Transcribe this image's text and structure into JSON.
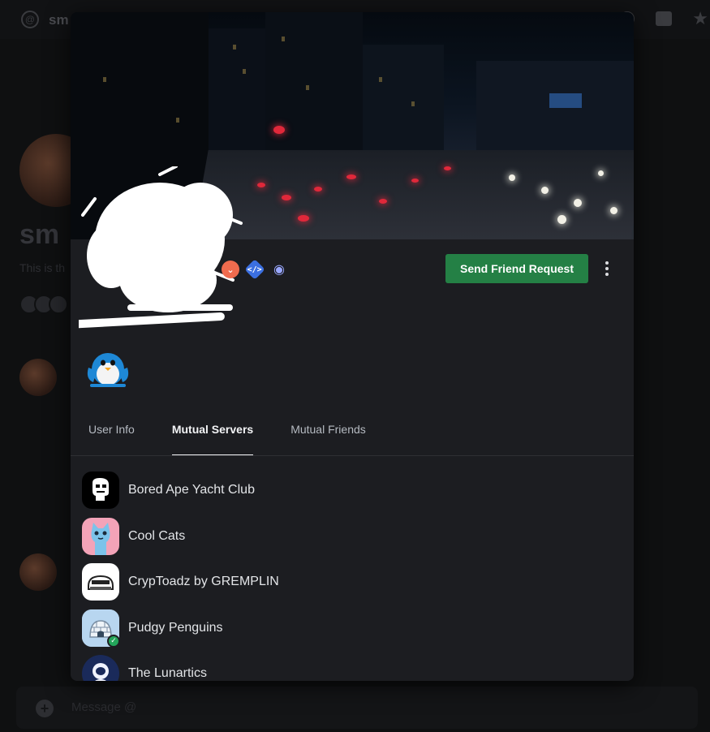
{
  "background": {
    "channel_name": "sm",
    "server_title": "sm",
    "description": "This is th",
    "composer_placeholder": "Message @"
  },
  "profile": {
    "badges": [
      {
        "name": "hypesquad-icon",
        "glyph": "⌄"
      },
      {
        "name": "active-developer-icon",
        "glyph": "</>"
      },
      {
        "name": "nitro-icon",
        "glyph": "◉"
      }
    ],
    "send_friend_request_label": "Send Friend Request",
    "tabs": [
      {
        "label": "User Info",
        "active": false
      },
      {
        "label": "Mutual Servers",
        "active": true
      },
      {
        "label": "Mutual Friends",
        "active": false
      }
    ],
    "mutual_servers": [
      {
        "name": "Bored Ape Yacht Club",
        "icon": "bayc-icon",
        "verified": false
      },
      {
        "name": "Cool Cats",
        "icon": "cool-cats-icon",
        "verified": false
      },
      {
        "name": "CrypToadz by GREMPLIN",
        "icon": "cryptoadz-icon",
        "verified": false
      },
      {
        "name": "Pudgy Penguins",
        "icon": "pudgy-penguins-icon",
        "verified": true
      },
      {
        "name": "The Lunartics",
        "icon": "lunartics-icon",
        "verified": false
      }
    ]
  },
  "colors": {
    "accent_green": "#248045",
    "modal_bg": "#1c1d21",
    "verified_green": "#23a55a"
  }
}
